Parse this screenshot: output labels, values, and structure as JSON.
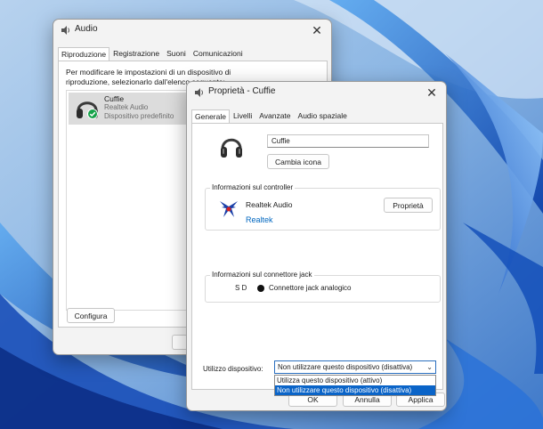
{
  "audio_window": {
    "title": "Audio",
    "tabs": [
      {
        "label": "Riproduzione"
      },
      {
        "label": "Registrazione"
      },
      {
        "label": "Suoni"
      },
      {
        "label": "Comunicazioni"
      }
    ],
    "instruction": "Per modificare le impostazioni di un dispositivo di riproduzione, selezionarlo dall'elenco seguente:",
    "device": {
      "name": "Cuffie",
      "driver": "Realtek Audio",
      "status": "Dispositivo predefinito"
    },
    "configure_label": "Configura"
  },
  "properties_window": {
    "title": "Proprietà - Cuffie",
    "tabs": [
      {
        "label": "Generale"
      },
      {
        "label": "Livelli"
      },
      {
        "label": "Avanzate"
      },
      {
        "label": "Audio spaziale"
      }
    ],
    "device_name_value": "Cuffie",
    "change_icon_label": "Cambia icona",
    "controller": {
      "legend": "Informazioni sul controller",
      "name": "Realtek Audio",
      "vendor_link": "Realtek",
      "properties_label": "Proprietà"
    },
    "jack": {
      "legend": "Informazioni sul connettore jack",
      "side_label": "S D",
      "connector": "Connettore jack analogico"
    },
    "usage": {
      "label": "Utilizzo dispositivo:",
      "selected": "Non utilizzare questo dispositivo (disattiva)",
      "options": [
        "Utilizza questo dispositivo (attivo)",
        "Non utilizzare questo dispositivo (disattiva)"
      ]
    },
    "buttons": {
      "ok": "OK",
      "cancel": "Annulla",
      "apply": "Applica"
    }
  },
  "colors": {
    "accent": "#0a64c8",
    "link": "#0067c0",
    "check_badge": "#16a34a"
  },
  "icons": [
    "speaker-icon",
    "headphones-icon",
    "check-badge-icon",
    "close-icon",
    "realtek-logo-icon",
    "jack-dot-icon",
    "chevron-down-icon"
  ]
}
